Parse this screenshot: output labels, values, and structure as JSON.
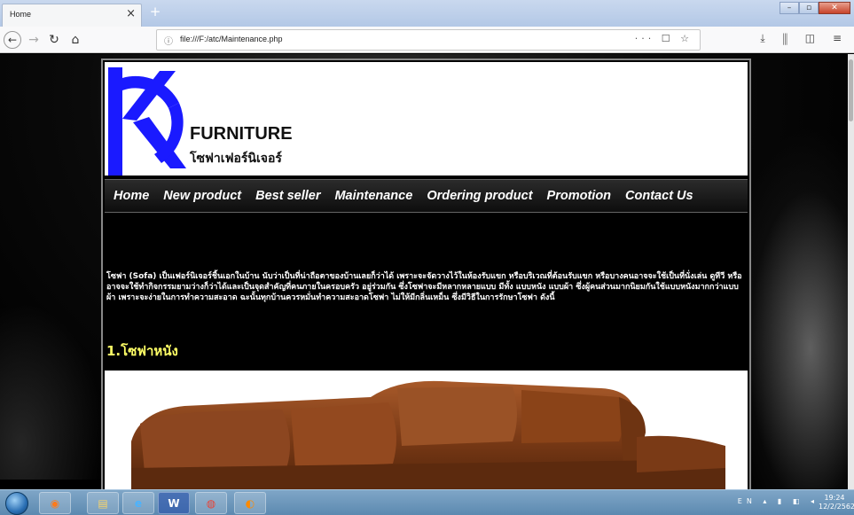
{
  "browser": {
    "tab_title": "Home",
    "tab_close": "×",
    "new_tab": "+",
    "url": "file:///F:/atc/Maintenance.php",
    "url_actions": "··· ☐ ☆"
  },
  "page": {
    "brand_en": "FURNITURE",
    "brand_th": "โซฟาเฟอร์นิเจอร์",
    "menu": [
      "Home",
      "New product",
      "Best seller",
      "Maintenance",
      "Ordering product",
      "Promotion",
      "Contact Us"
    ],
    "intro": "โซฟา (Sofa) เป็นเฟอร์นิเจอร์ชิ้นเอกในบ้าน นับว่าเป็นที่น่าถือตาของบ้านเลยก็ว่าได้ เพราะจะจัดวางไว้ในห้องรับแขก หรือบริเวณที่ต้อนรับแขก หรือบางคนอาจจะใช้เป็นที่นั่งเล่น ดูทีวี หรืออาจจะใช้ทำกิจกรรมยามว่างก็ว่าได้และเป็นจุดสำคัญที่คนภายในครอบครัว อยู่ร่วมกัน ซึ่งโซฟาจะมีหลากหลายแบบ มีทั้ง แบบหนัง แบบผ้า ซึ่งผู้คนส่วนมากนิยมกันใช้แบบหนังมากกว่าแบบผ้า เพราะจะง่ายในการทำความสะอาด ฉะนั้นทุกบ้านควรหมั่นทำความสะอาดโซฟา ไม่ให้มีกลิ่นเหม็น ซึ่งมีวิธีในการรักษาโซฟา ดังนี้",
    "heading1": "1.โซฟาหนัง"
  },
  "taskbar": {
    "word_label": "W",
    "lang": "EN",
    "time": "19:24",
    "date": "12/2/2562"
  }
}
